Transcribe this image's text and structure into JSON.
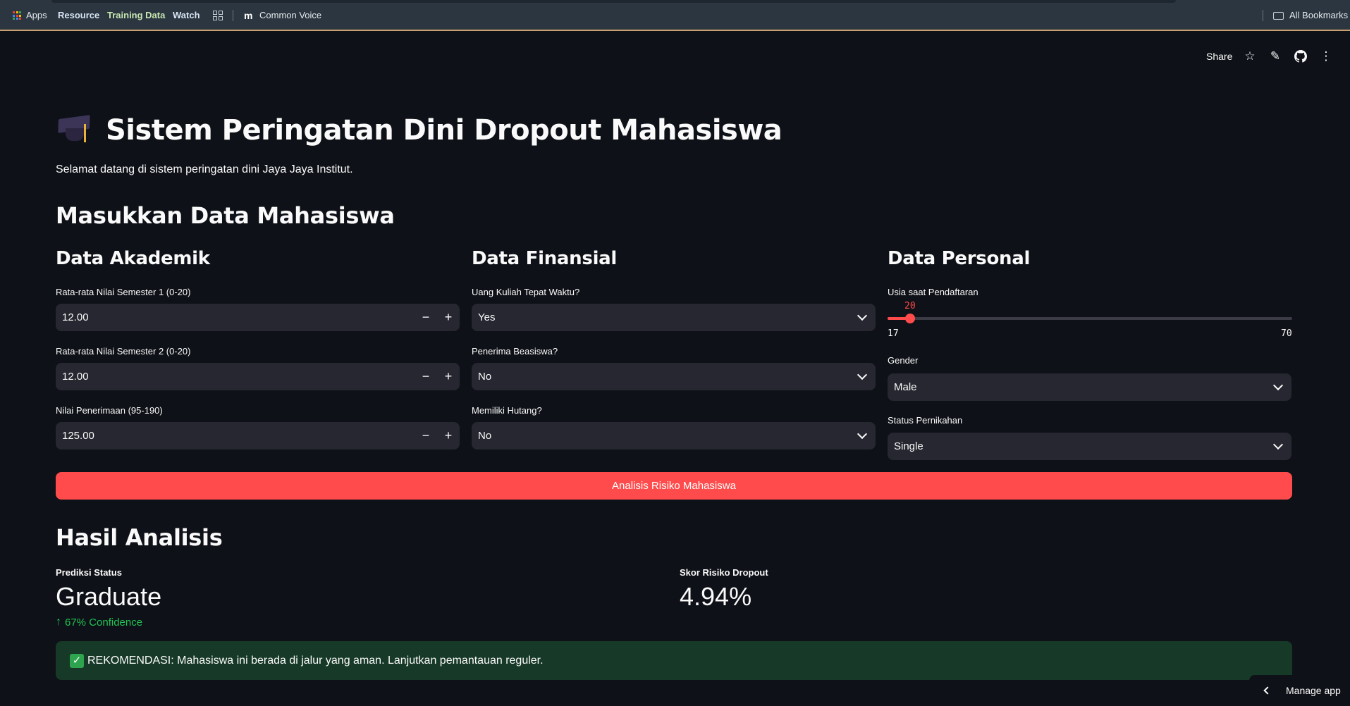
{
  "bookmarks": {
    "apps": "Apps",
    "items": [
      "Resource",
      "Training Data",
      "Watch"
    ],
    "common_voice": "Common Voice",
    "all_bookmarks": "All Bookmarks"
  },
  "header": {
    "share": "Share",
    "icons": [
      "star-icon",
      "pencil-icon",
      "github-icon",
      "more-icon"
    ]
  },
  "page": {
    "title": "Sistem Peringatan Dini Dropout Mahasiswa",
    "welcome": "Selamat datang di sistem peringatan dini Jaya Jaya Institut.",
    "section_input": "Masukkan Data Mahasiswa"
  },
  "akademik": {
    "heading": "Data Akademik",
    "sem1_label": "Rata-rata Nilai Semester 1 (0-20)",
    "sem1_value": "12.00",
    "sem2_label": "Rata-rata Nilai Semester 2 (0-20)",
    "sem2_value": "12.00",
    "admission_label": "Nilai Penerimaan (95-190)",
    "admission_value": "125.00",
    "minus": "−",
    "plus": "+"
  },
  "finansial": {
    "heading": "Data Finansial",
    "tuition_label": "Uang Kuliah Tepat Waktu?",
    "tuition_value": "Yes",
    "scholarship_label": "Penerima Beasiswa?",
    "scholarship_value": "No",
    "debt_label": "Memiliki Hutang?",
    "debt_value": "No"
  },
  "personal": {
    "heading": "Data Personal",
    "age_label": "Usia saat Pendaftaran",
    "age_value": "20",
    "age_min": "17",
    "age_max": "70",
    "age_fraction": 0.0566,
    "gender_label": "Gender",
    "gender_value": "Male",
    "marital_label": "Status Pernikahan",
    "marital_value": "Single"
  },
  "action": {
    "analyze_label": "Analisis Risiko Mahasiswa"
  },
  "results": {
    "heading": "Hasil Analisis",
    "status_label": "Prediksi Status",
    "status_value": "Graduate",
    "confidence": "67% Confidence",
    "risk_label": "Skor Risiko Dropout",
    "risk_value": "4.94%",
    "recommendation": "REKOMENDASI: Mahasiswa ini berada di jalur yang aman. Lanjutkan pemantauan reguler."
  },
  "footer": {
    "manage_app": "Manage app"
  },
  "colors": {
    "accent": "#ff4b4b",
    "background": "#0e1117",
    "input_bg": "#262730",
    "success_bg": "#173928",
    "delta_green": "#21c354"
  }
}
